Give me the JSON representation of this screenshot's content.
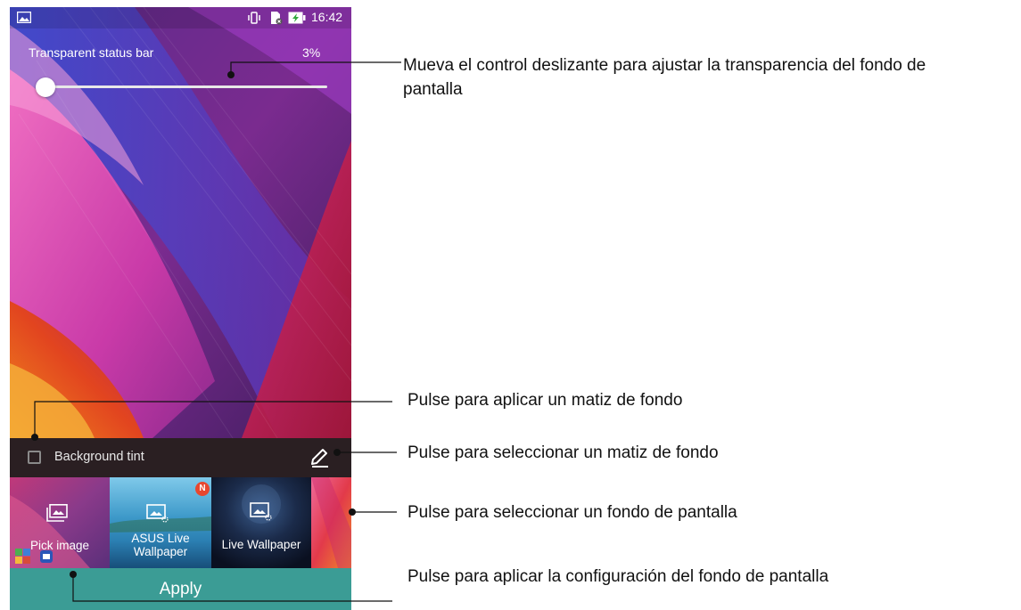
{
  "status_bar": {
    "time": "16:42"
  },
  "transparency": {
    "label": "Transparent status bar",
    "value_text": "3%",
    "level_percent": 3
  },
  "background_tint": {
    "label": "Background tint",
    "checked": false
  },
  "wallpaper_options": [
    {
      "label": "Pick image",
      "icon": "picture-icon"
    },
    {
      "label_line1": "ASUS Live",
      "label_line2": "Wallpaper",
      "badge": "N",
      "icon": "live-image-icon"
    },
    {
      "label": "Live Wallpaper",
      "icon": "live-image-icon"
    }
  ],
  "apply_label": "Apply",
  "colors": {
    "accent": "#3b9c95",
    "badge": "#e8472f"
  },
  "callouts": {
    "slider_line1": "Mueva el control deslizante para ajustar la transparencia del fondo de",
    "slider_line2": "pantalla",
    "tint_apply": "Pulse para aplicar un matiz de fondo",
    "tint_select": "Pulse para seleccionar un matiz de fondo",
    "wallpaper_select": "Pulse para seleccionar un fondo de pantalla",
    "apply_settings": "Pulse para aplicar la configuración del fondo de pantalla"
  }
}
